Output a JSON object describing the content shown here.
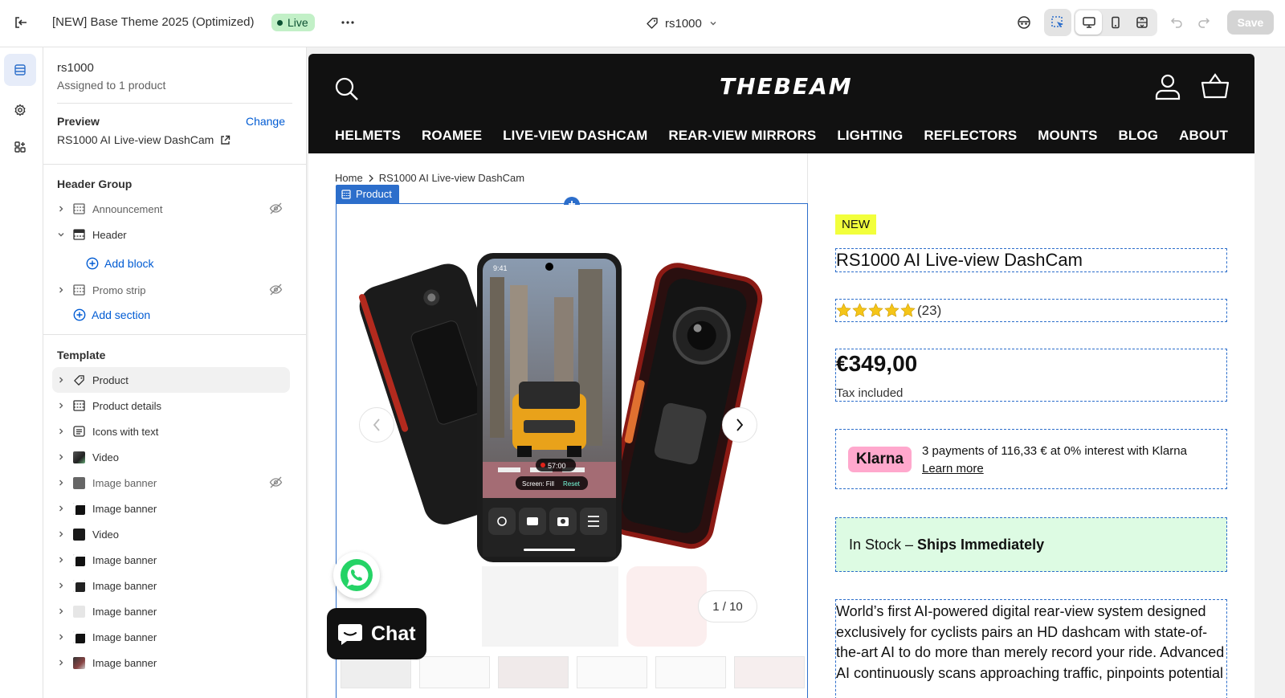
{
  "topbar": {
    "theme_name": "[NEW] Base Theme 2025 (Optimized)",
    "live_badge": "Live",
    "template_select": "rs1000",
    "save_label": "Save"
  },
  "sidebar": {
    "template_title": "rs1000",
    "assigned": "Assigned to 1 product",
    "preview_label": "Preview",
    "change_label": "Change",
    "preview_product": "RS1000 AI Live-view DashCam",
    "header_group": {
      "label": "Header Group",
      "items": [
        {
          "label": "Announcement",
          "icon": "section-icon",
          "hidden": true
        },
        {
          "label": "Header",
          "icon": "header-icon",
          "expanded": true
        },
        {
          "label": "Promo strip",
          "icon": "section-icon",
          "hidden": true
        }
      ],
      "add_block": "Add block",
      "add_section": "Add section"
    },
    "template": {
      "label": "Template",
      "items": [
        {
          "label": "Product",
          "icon": "tag-icon"
        },
        {
          "label": "Product details",
          "icon": "section-icon"
        },
        {
          "label": "Icons with text",
          "icon": "text-icon"
        },
        {
          "label": "Video",
          "icon": "video-thumb"
        },
        {
          "label": "Image banner",
          "icon": "image-thumb",
          "hidden": true
        },
        {
          "label": "Image banner",
          "icon": "image-thumb"
        },
        {
          "label": "Video",
          "icon": "video-thumb"
        },
        {
          "label": "Image banner",
          "icon": "image-thumb"
        },
        {
          "label": "Image banner",
          "icon": "image-thumb"
        },
        {
          "label": "Image banner",
          "icon": "image-thumb"
        },
        {
          "label": "Image banner",
          "icon": "image-thumb"
        },
        {
          "label": "Image banner",
          "icon": "image-thumb"
        }
      ]
    }
  },
  "store": {
    "logo": "THEBEAM",
    "nav": [
      "HELMETS",
      "ROAMEE",
      "LIVE-VIEW DASHCAM",
      "REAR-VIEW MIRRORS",
      "LIGHTING",
      "REFLECTORS",
      "MOUNTS",
      "BLOG",
      "ABOUT"
    ],
    "breadcrumb_home": "Home",
    "breadcrumb_current": "RS1000 AI Live-view DashCam",
    "section_tag": "Product",
    "gallery_counter": "1 / 10",
    "phone_timer": "57:00",
    "phone_screen_fill": "Screen: Fill",
    "phone_reset": "Reset",
    "phone_time": "9:41",
    "chat_label": "Chat"
  },
  "product": {
    "badge": "NEW",
    "title": "RS1000 AI Live-view DashCam",
    "rating": 5,
    "reviews": "(23)",
    "price": "€349,00",
    "tax": "Tax included",
    "klarna_logo": "Klarna",
    "klarna_text": "3 payments of 116,33 € at 0% interest with Klarna",
    "klarna_link": "Learn more",
    "stock_prefix": "In Stock – ",
    "stock_bold": "Ships Immediately",
    "description": "World’s first AI-powered digital rear-view system designed exclusively for cyclists pairs an HD dashcam with state-of-the-art AI to do more than merely record your ride. Advanced AI continuously scans approaching traffic, pinpoints potential"
  },
  "colors": {
    "accent": "#2c6ecb",
    "live_bg": "#c2f0c7",
    "stock_bg": "#ddfbe3",
    "new_badge": "#f2ff3c",
    "klarna_pink": "#ffa8cd"
  }
}
